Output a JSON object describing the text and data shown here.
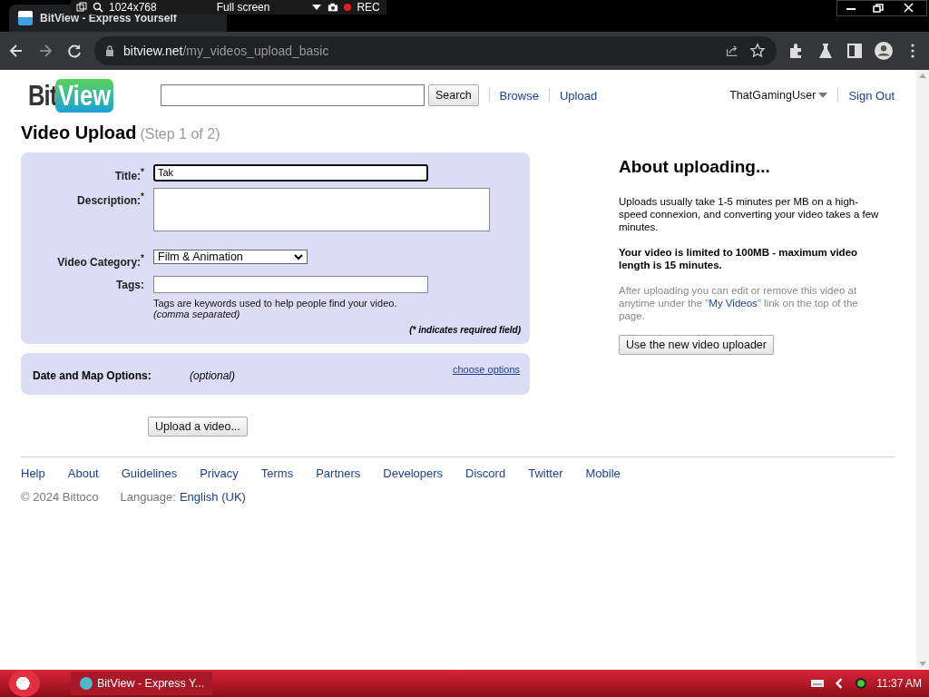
{
  "recorder_bar": {
    "resolution": "1024x768",
    "mode": "Full screen",
    "rec": "REC"
  },
  "browser": {
    "tab_title": "BitView - Express Yourself",
    "url_host": "bitview.net",
    "url_path": "/my_videos_upload_basic"
  },
  "header": {
    "logo_left": "Bit",
    "logo_right": "View",
    "search_button": "Search",
    "nav": [
      "Browse",
      "Upload"
    ],
    "user": "ThatGamingUser",
    "sign_out": "Sign Out"
  },
  "page_title": "Video Upload",
  "step": "(Step 1 of 2)",
  "form": {
    "fields": [
      {
        "kind": "text",
        "label": "Title:$^{*}$",
        "value": "Tak",
        "focused": true
      },
      {
        "kind": "textarea",
        "label": "Description:$^{*}$",
        "focused": false
      },
      {
        "kind": "select",
        "label": "Video Category:$^{*}$",
        "value": "Film & Animation",
        "focused": false
      },
      {
        "kind": "text",
        "label": "Tags:",
        "focused": false,
        "help": "Tags are keywords used to help people find your video.",
        "help_note": "(comma separated)"
      }
    ],
    "required_note": "(* indicates required field)"
  },
  "options": {
    "label": "Date and Map Options:",
    "optional": "(optional)",
    "link": "choose options"
  },
  "upload_button": "Upload a video...",
  "about": {
    "heading": "About uploading...",
    "paragraphs": [
      {
        "kind": "plain",
        "text": "Uploads usually take 1-5 minutes per MB on a high-speed connexion, and converting your video takes a few minutes."
      },
      {
        "kind": "bold",
        "text": "Your video is limited to 100MB - maximum video length is 15 minutes."
      },
      {
        "kind": "muted",
        "text": "After uploading you can edit or remove this video at anytime under the \"",
        "link": "My Videos",
        "after": "\" link on the top of the page."
      }
    ],
    "button": "Use the new video uploader"
  },
  "footer": {
    "links": [
      "Help",
      "About",
      "Guidelines",
      "Privacy",
      "Terms",
      "Partners",
      "Developers",
      "Discord",
      "Twitter",
      "Mobile"
    ],
    "copyright": "© 2024 Bittoco",
    "language_label": "Language:",
    "language": "English (UK)"
  },
  "taskbar": {
    "window": "BitView - Express Y...",
    "time": "11:37 AM"
  }
}
